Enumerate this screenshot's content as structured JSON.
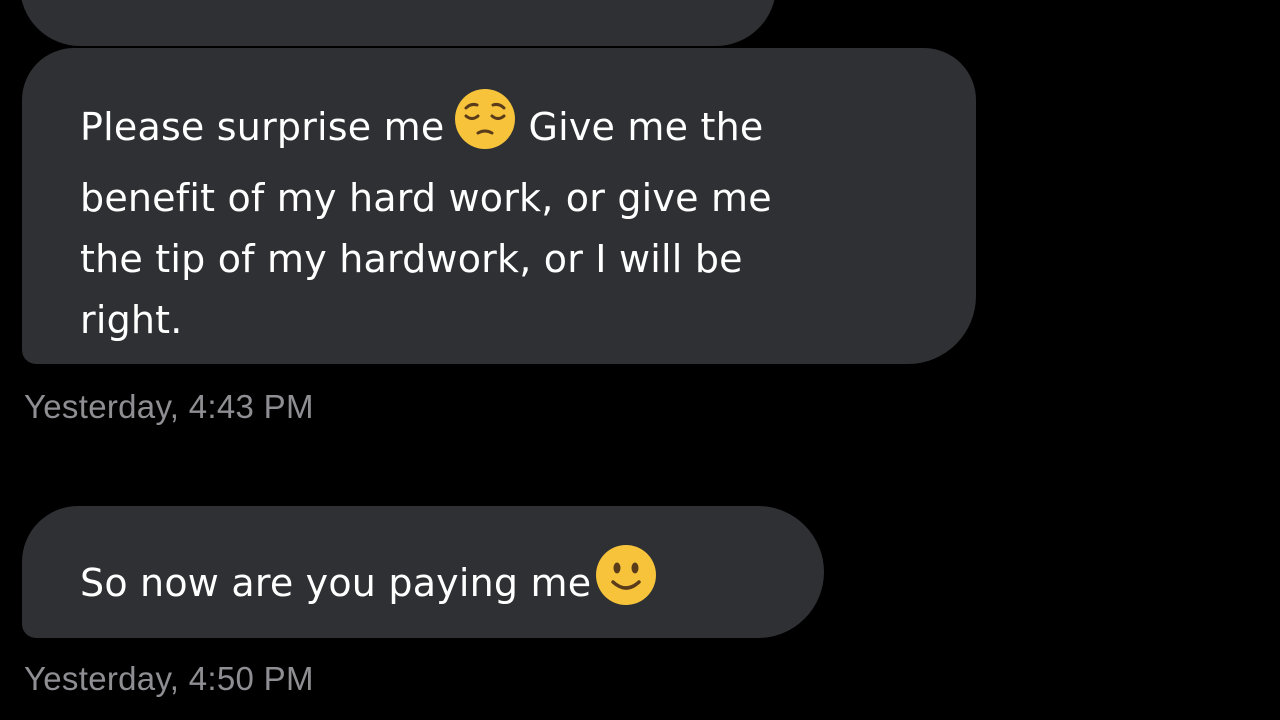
{
  "messages": [
    {
      "text_before_emoji": "Please surprise me",
      "emoji": "pensive-face",
      "text_after_emoji": "Give me the\nbenefit of my hard work, or give me\nthe tip of my hardwork, or I will be\nright.",
      "timestamp": "Yesterday, 4:43 PM"
    },
    {
      "text_before_emoji": "So now are you paying me",
      "emoji": "slightly-smiling-face",
      "timestamp": "Yesterday, 4:50 PM"
    }
  ],
  "colors": {
    "background": "#000000",
    "bubble": "#2f3033",
    "text": "#ffffff",
    "timestamp": "#8e8e93",
    "emoji_yellow": "#f6c33b"
  }
}
